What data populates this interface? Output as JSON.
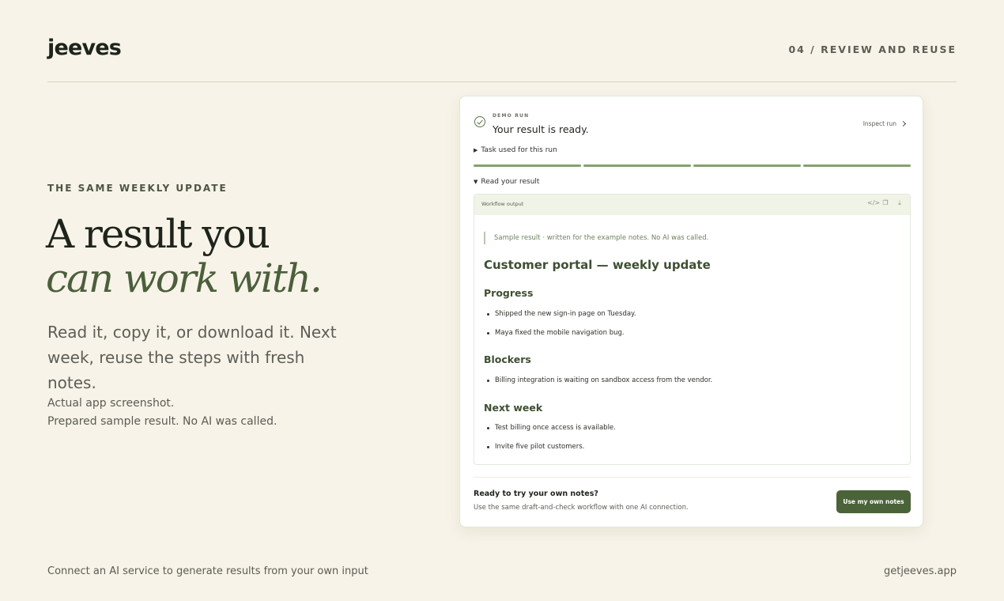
{
  "brand": "jeeves",
  "step_label": "04 / REVIEW AND REUSE",
  "left": {
    "eyebrow": "THE SAME WEEKLY UPDATE",
    "headline_line1": "A result you",
    "headline_line2": "can work with.",
    "lede": "Read it, copy it, or download it. Next week, reuse the steps with fresh notes.",
    "note_line1": "Actual app screenshot.",
    "note_line2": "Prepared sample result. No AI was called."
  },
  "app": {
    "demo_label": "DEMO RUN",
    "status_title": "Your result is ready.",
    "inspect_link": "Inspect run",
    "task_toggle": "Task used for this run",
    "read_toggle": "Read your result",
    "progress_segments_complete": 4,
    "output": {
      "title": "Workflow output",
      "tools": [
        "code-icon",
        "copy-icon",
        "download-icon"
      ],
      "sample_note": "Sample result · written for the example notes. No AI was called.",
      "heading": "Customer portal — weekly update",
      "sections": [
        {
          "title": "Progress",
          "items": [
            "Shipped the new sign-in page on Tuesday.",
            "Maya fixed the mobile navigation bug."
          ]
        },
        {
          "title": "Blockers",
          "items": [
            "Billing integration is waiting on sandbox access from the vendor."
          ]
        },
        {
          "title": "Next week",
          "items": [
            "Test billing once access is available.",
            "Invite five pilot customers."
          ]
        }
      ]
    },
    "cta": {
      "title": "Ready to try your own notes?",
      "subtitle": "Use the same draft-and-check workflow with one AI connection.",
      "button": "Use my own notes"
    }
  },
  "footer": {
    "left": "Connect an AI service to generate results from your own input",
    "right": "getjeeves.app"
  },
  "colors": {
    "background": "#f7f3e8",
    "accent": "#4b6339",
    "progress": "#86a06f"
  }
}
